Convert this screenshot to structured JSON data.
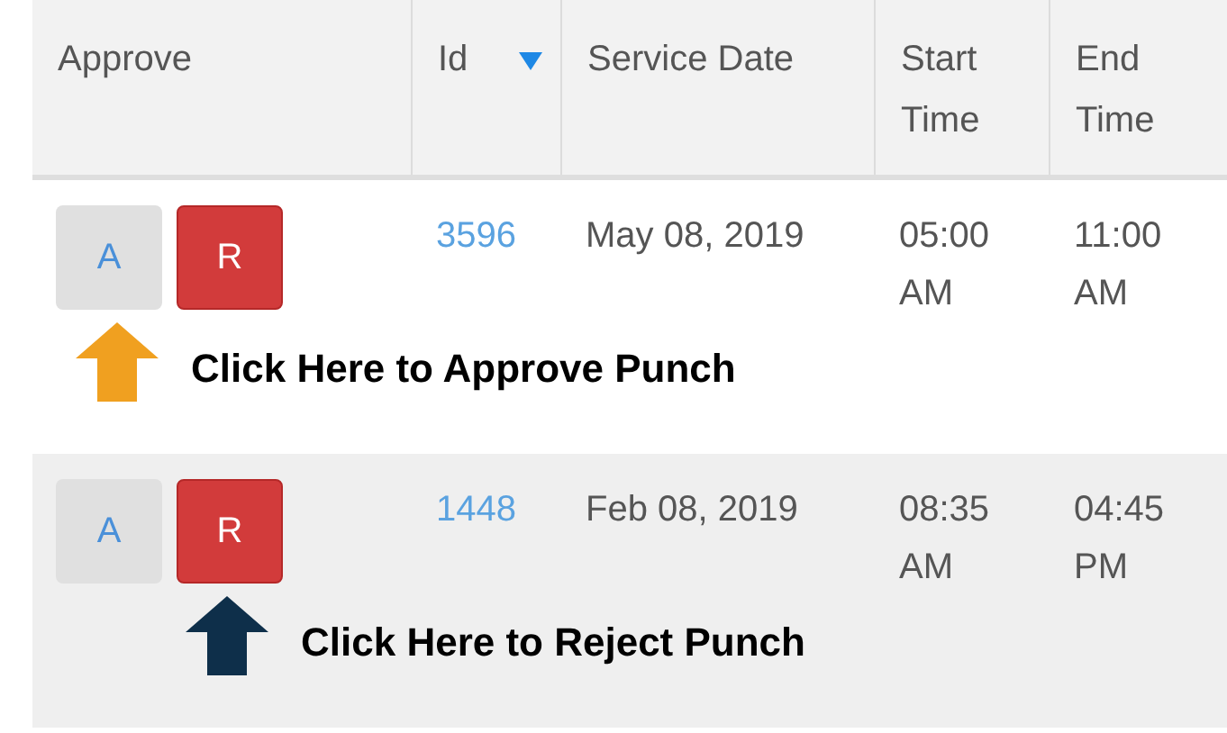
{
  "table": {
    "columns": [
      {
        "label": "Approve",
        "sorted": false
      },
      {
        "label": "Id",
        "sorted": true
      },
      {
        "label": "Service Date",
        "sorted": false
      },
      {
        "label": "Start Time",
        "sorted": false
      },
      {
        "label": "End Time",
        "sorted": false
      }
    ],
    "rows": [
      {
        "approve_label": "A",
        "reject_label": "R",
        "id": "3596",
        "service_date": "May 08, 2019",
        "start_time": "05:00 AM",
        "end_time": "11:00 AM",
        "callout": {
          "text": "Click Here to Approve Punch",
          "kind": "approve",
          "color": "#f0a020"
        }
      },
      {
        "approve_label": "A",
        "reject_label": "R",
        "id": "1448",
        "service_date": "Feb 08, 2019",
        "start_time": "08:35 AM",
        "end_time": "04:45 PM",
        "callout": {
          "text": "Click Here to Reject Punch",
          "kind": "reject",
          "color": "#0e2f4a"
        }
      }
    ]
  }
}
